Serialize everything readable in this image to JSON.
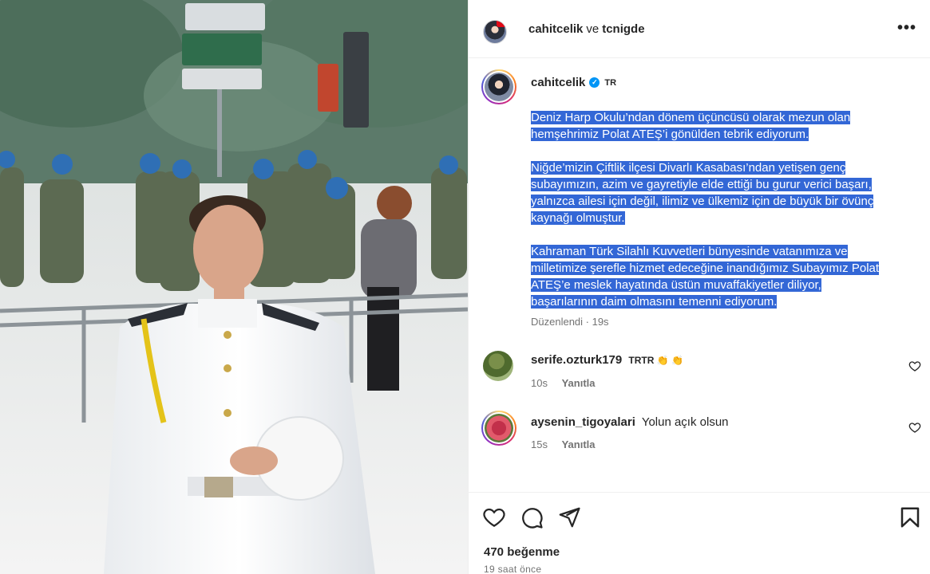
{
  "header": {
    "user1": "cahitcelik",
    "conj": "ve",
    "user2": "tcnigde",
    "more": "•••"
  },
  "caption": {
    "username": "cahitcelik",
    "verified_mark": "✓",
    "tag": "TR",
    "paragraphs": [
      [
        "Deniz Harp Okulu’ndan dönem üçüncüsü olarak mezun olan",
        "hemşehrimiz Polat ATEŞ’i gönülden tebrik ediyorum."
      ],
      [
        "Niğde’mizin Çiftlik ilçesi Divarlı Kasabası’ndan yetişen genç",
        "subayımızın, azim ve gayretiyle elde ettiği bu gurur verici başarı,",
        "yalnızca ailesi için değil, ilimiz ve ülkemiz için de büyük bir övünç",
        "kaynağı olmuştur."
      ],
      [
        "Kahraman Türk Silahlı Kuvvetleri bünyesinde vatanımıza ve",
        "milletimize şerefle hizmet edeceğine inandığımız Subayımız Polat",
        "ATEŞ’e meslek hayatında üstün muvaffakiyetler diliyor,",
        "başarılarının daim olmasını temenni ediyorum."
      ]
    ],
    "edited": "Düzenlendi · 19s"
  },
  "comments": [
    {
      "username": "serife.ozturk179",
      "text": "TRTR 👏 👏",
      "time": "10s",
      "reply": "Yanıtla"
    },
    {
      "username": "aysenin_tigoyalari",
      "text": "Yolun açık olsun",
      "time": "15s",
      "reply": "Yanıtla"
    }
  ],
  "actions": {
    "like_icon": "heart-icon",
    "comment_icon": "comment-icon",
    "share_icon": "share-icon",
    "save_icon": "bookmark-icon"
  },
  "likes": "470 beğenme",
  "posted": "19 saat önce",
  "colors": {
    "selection": "#3367d6",
    "verified": "#0095f6",
    "muted": "#737373"
  }
}
